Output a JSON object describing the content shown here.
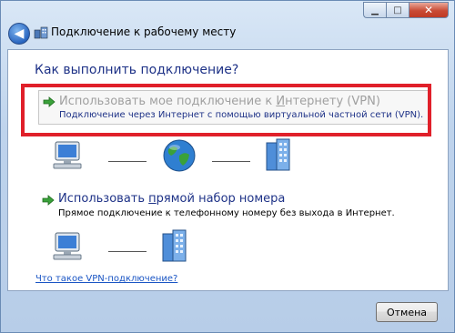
{
  "window": {
    "title": "Подключение к рабочему месту",
    "minimize_glyph": "▁",
    "maximize_glyph": "□",
    "close_glyph": "✕",
    "back_glyph": "◀"
  },
  "heading": "Как выполнить подключение?",
  "options": [
    {
      "title_pre": "Использовать мое подключение к ",
      "title_u": "И",
      "title_post": "нтернету (VPN)",
      "description": "Подключение через Интернет с помощью виртуальной частной сети (VPN).",
      "icon": "green-arrow-icon"
    },
    {
      "title_pre": "Использовать ",
      "title_u": "п",
      "title_post": "рямой набор номера",
      "description": "Прямое подключение к телефонному номеру без выхода в Интернет.",
      "icon": "green-arrow-icon"
    }
  ],
  "diagram_icons": [
    "computer-icon",
    "globe-icon",
    "building-icon"
  ],
  "help_link": "Что такое VPN-подключение?",
  "cancel_button": "Отмена",
  "colors": {
    "heading": "#1e3287",
    "highlight_border": "#e0202a",
    "link": "#1a55c4"
  }
}
